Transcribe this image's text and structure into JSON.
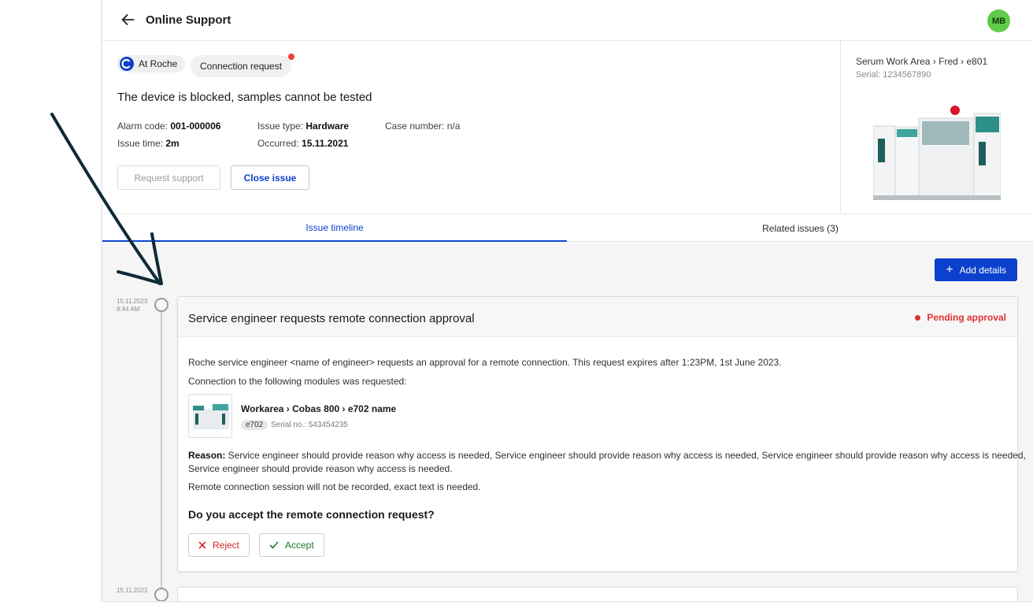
{
  "topbar": {
    "title": "Online Support",
    "avatar": "MB"
  },
  "header": {
    "chip_org": "At Roche",
    "chip_request": "Connection request",
    "issue_title": "The device is blocked, samples cannot be tested",
    "alarm_label": "Alarm code: ",
    "alarm_value": "001-000006",
    "issue_time_label": "Issue time: ",
    "issue_time_value": "2m",
    "issue_type_label": "Issue type: ",
    "issue_type_value": "Hardware",
    "occurred_label": "Occurred: ",
    "occurred_value": "15.11.2021",
    "case_label": "Case number: n/a",
    "btn_request": "Request support",
    "btn_close": "Close issue"
  },
  "device": {
    "path": "Serum Work Area › Fred › e801",
    "serial": "Serial: 1234567890"
  },
  "tabs": [
    {
      "label": "Issue timeline",
      "active": true
    },
    {
      "label": "Related issues (3)",
      "active": false
    }
  ],
  "actions": {
    "add_details": "Add details"
  },
  "timeline": [
    {
      "date": "15.11.2023",
      "time": "8:44 AM"
    },
    {
      "date": "15.11.2023",
      "time": ""
    }
  ],
  "card": {
    "title": "Service engineer requests remote connection approval",
    "status": "Pending approval",
    "desc": "Roche service engineer <name of engineer> requests an approval for a remote connection. This request expires after 1:23PM, 1st June 2023.",
    "modules_intro": "Connection to the following modules was requested:",
    "module_name": "Workarea › Cobas 800 › e702 name",
    "module_tag": "e702",
    "module_serial": "Serial no.: 543454235",
    "reason_label": "Reason:",
    "reason_text1": " Service engineer should provide reason why access is needed, Service engineer should provide reason why access is needed, Service engineer should provide reason why access is needed,",
    "reason_text2": "Service engineer should provide reason why access is needed.",
    "recording_note": "Remote connection session will not be recorded, exact text is needed.",
    "question": "Do you accept the remote connection request?",
    "reject": "Reject",
    "accept": "Accept"
  },
  "colors": {
    "brand": "#0b41cd",
    "pending": "#e03131",
    "avatar": "#5fcb4a",
    "accept": "#1a7a2a"
  }
}
